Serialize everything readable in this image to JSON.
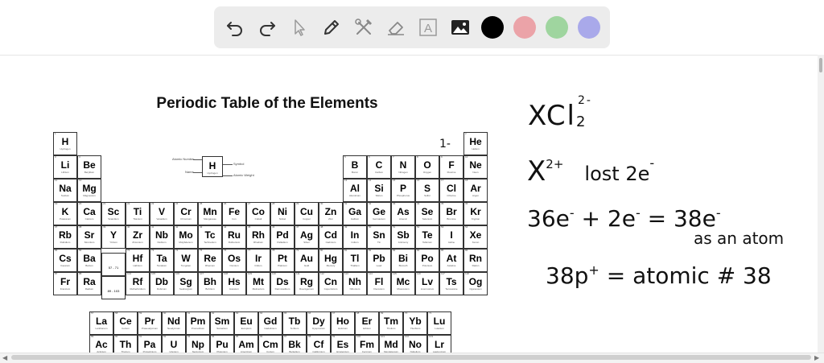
{
  "toolbar": {
    "tools": [
      "undo-icon",
      "redo-icon",
      "pointer-icon",
      "pen-icon",
      "tools-icon",
      "eraser-icon",
      "text-icon",
      "image-icon"
    ],
    "text_tool_label": "A",
    "colors": [
      "#000000",
      "#eba3a8",
      "#9fd59f",
      "#a9a9ea"
    ]
  },
  "table": {
    "title": "Periodic Table of the Elements",
    "key": {
      "atomic_number": "Atomic Number",
      "name": "Name",
      "symbol_label": "Symbol",
      "weight_label": "Atomic Weight",
      "symbol": "H",
      "element_name": "Hydrogen"
    },
    "lanthanide_placeholder": "57 - 71 Lanthanides",
    "actinide_placeholder": "89 - 103 Actinides",
    "elements": [
      {
        "n": "1",
        "s": "H",
        "nm": "Hydrogen",
        "r": 1,
        "c": 1
      },
      {
        "n": "2",
        "s": "He",
        "nm": "Helium",
        "r": 1,
        "c": 18
      },
      {
        "n": "3",
        "s": "Li",
        "nm": "Lithium",
        "r": 2,
        "c": 1
      },
      {
        "n": "4",
        "s": "Be",
        "nm": "Beryllium",
        "r": 2,
        "c": 2
      },
      {
        "n": "5",
        "s": "B",
        "nm": "Boron",
        "r": 2,
        "c": 13
      },
      {
        "n": "6",
        "s": "C",
        "nm": "Carbon",
        "r": 2,
        "c": 14
      },
      {
        "n": "7",
        "s": "N",
        "nm": "Nitrogen",
        "r": 2,
        "c": 15
      },
      {
        "n": "8",
        "s": "O",
        "nm": "Oxygen",
        "r": 2,
        "c": 16
      },
      {
        "n": "9",
        "s": "F",
        "nm": "Fluorine",
        "r": 2,
        "c": 17
      },
      {
        "n": "10",
        "s": "Ne",
        "nm": "Neon",
        "r": 2,
        "c": 18
      },
      {
        "n": "11",
        "s": "Na",
        "nm": "Sodium",
        "r": 3,
        "c": 1
      },
      {
        "n": "12",
        "s": "Mg",
        "nm": "Magnesium",
        "r": 3,
        "c": 2
      },
      {
        "n": "13",
        "s": "Al",
        "nm": "Aluminium",
        "r": 3,
        "c": 13
      },
      {
        "n": "14",
        "s": "Si",
        "nm": "Silicon",
        "r": 3,
        "c": 14
      },
      {
        "n": "15",
        "s": "P",
        "nm": "Phosphorus",
        "r": 3,
        "c": 15
      },
      {
        "n": "16",
        "s": "S",
        "nm": "Sulfur",
        "r": 3,
        "c": 16
      },
      {
        "n": "17",
        "s": "Cl",
        "nm": "Chlorine",
        "r": 3,
        "c": 17
      },
      {
        "n": "18",
        "s": "Ar",
        "nm": "Argon",
        "r": 3,
        "c": 18
      },
      {
        "n": "19",
        "s": "K",
        "nm": "Potassium",
        "r": 4,
        "c": 1
      },
      {
        "n": "20",
        "s": "Ca",
        "nm": "Calcium",
        "r": 4,
        "c": 2
      },
      {
        "n": "21",
        "s": "Sc",
        "nm": "Scandium",
        "r": 4,
        "c": 3
      },
      {
        "n": "22",
        "s": "Ti",
        "nm": "Titanium",
        "r": 4,
        "c": 4
      },
      {
        "n": "23",
        "s": "V",
        "nm": "Vanadium",
        "r": 4,
        "c": 5
      },
      {
        "n": "24",
        "s": "Cr",
        "nm": "Chromium",
        "r": 4,
        "c": 6
      },
      {
        "n": "25",
        "s": "Mn",
        "nm": "Manganese",
        "r": 4,
        "c": 7
      },
      {
        "n": "26",
        "s": "Fe",
        "nm": "Iron",
        "r": 4,
        "c": 8
      },
      {
        "n": "27",
        "s": "Co",
        "nm": "Cobalt",
        "r": 4,
        "c": 9
      },
      {
        "n": "28",
        "s": "Ni",
        "nm": "Nickel",
        "r": 4,
        "c": 10
      },
      {
        "n": "29",
        "s": "Cu",
        "nm": "Copper",
        "r": 4,
        "c": 11
      },
      {
        "n": "30",
        "s": "Zn",
        "nm": "Zinc",
        "r": 4,
        "c": 12
      },
      {
        "n": "31",
        "s": "Ga",
        "nm": "Gallium",
        "r": 4,
        "c": 13
      },
      {
        "n": "32",
        "s": "Ge",
        "nm": "Germanium",
        "r": 4,
        "c": 14
      },
      {
        "n": "33",
        "s": "As",
        "nm": "Arsenic",
        "r": 4,
        "c": 15
      },
      {
        "n": "34",
        "s": "Se",
        "nm": "Selenium",
        "r": 4,
        "c": 16
      },
      {
        "n": "35",
        "s": "Br",
        "nm": "Bromine",
        "r": 4,
        "c": 17
      },
      {
        "n": "36",
        "s": "Kr",
        "nm": "Krypton",
        "r": 4,
        "c": 18
      },
      {
        "n": "37",
        "s": "Rb",
        "nm": "Rubidium",
        "r": 5,
        "c": 1
      },
      {
        "n": "38",
        "s": "Sr",
        "nm": "Strontium",
        "r": 5,
        "c": 2
      },
      {
        "n": "39",
        "s": "Y",
        "nm": "Yttrium",
        "r": 5,
        "c": 3
      },
      {
        "n": "40",
        "s": "Zr",
        "nm": "Zirconium",
        "r": 5,
        "c": 4
      },
      {
        "n": "41",
        "s": "Nb",
        "nm": "Niobium",
        "r": 5,
        "c": 5
      },
      {
        "n": "42",
        "s": "Mo",
        "nm": "Molybdenum",
        "r": 5,
        "c": 6
      },
      {
        "n": "43",
        "s": "Tc",
        "nm": "Technetium",
        "r": 5,
        "c": 7
      },
      {
        "n": "44",
        "s": "Ru",
        "nm": "Ruthenium",
        "r": 5,
        "c": 8
      },
      {
        "n": "45",
        "s": "Rh",
        "nm": "Rhodium",
        "r": 5,
        "c": 9
      },
      {
        "n": "46",
        "s": "Pd",
        "nm": "Palladium",
        "r": 5,
        "c": 10
      },
      {
        "n": "47",
        "s": "Ag",
        "nm": "Silver",
        "r": 5,
        "c": 11
      },
      {
        "n": "48",
        "s": "Cd",
        "nm": "Cadmium",
        "r": 5,
        "c": 12
      },
      {
        "n": "49",
        "s": "In",
        "nm": "Indium",
        "r": 5,
        "c": 13
      },
      {
        "n": "50",
        "s": "Sn",
        "nm": "Tin",
        "r": 5,
        "c": 14
      },
      {
        "n": "51",
        "s": "Sb",
        "nm": "Antimony",
        "r": 5,
        "c": 15
      },
      {
        "n": "52",
        "s": "Te",
        "nm": "Tellurium",
        "r": 5,
        "c": 16
      },
      {
        "n": "53",
        "s": "I",
        "nm": "Iodine",
        "r": 5,
        "c": 17
      },
      {
        "n": "54",
        "s": "Xe",
        "nm": "Xenon",
        "r": 5,
        "c": 18
      },
      {
        "n": "55",
        "s": "Cs",
        "nm": "Caesium",
        "r": 6,
        "c": 1
      },
      {
        "n": "56",
        "s": "Ba",
        "nm": "Barium",
        "r": 6,
        "c": 2
      },
      {
        "n": "72",
        "s": "Hf",
        "nm": "Hafnium",
        "r": 6,
        "c": 4
      },
      {
        "n": "73",
        "s": "Ta",
        "nm": "Tantalum",
        "r": 6,
        "c": 5
      },
      {
        "n": "74",
        "s": "W",
        "nm": "Tungsten",
        "r": 6,
        "c": 6
      },
      {
        "n": "75",
        "s": "Re",
        "nm": "Rhenium",
        "r": 6,
        "c": 7
      },
      {
        "n": "76",
        "s": "Os",
        "nm": "Osmium",
        "r": 6,
        "c": 8
      },
      {
        "n": "77",
        "s": "Ir",
        "nm": "Iridium",
        "r": 6,
        "c": 9
      },
      {
        "n": "78",
        "s": "Pt",
        "nm": "Platinum",
        "r": 6,
        "c": 10
      },
      {
        "n": "79",
        "s": "Au",
        "nm": "Gold",
        "r": 6,
        "c": 11
      },
      {
        "n": "80",
        "s": "Hg",
        "nm": "Mercury",
        "r": 6,
        "c": 12
      },
      {
        "n": "81",
        "s": "Tl",
        "nm": "Thallium",
        "r": 6,
        "c": 13
      },
      {
        "n": "82",
        "s": "Pb",
        "nm": "Lead",
        "r": 6,
        "c": 14
      },
      {
        "n": "83",
        "s": "Bi",
        "nm": "Bismuth",
        "r": 6,
        "c": 15
      },
      {
        "n": "84",
        "s": "Po",
        "nm": "Polonium",
        "r": 6,
        "c": 16
      },
      {
        "n": "85",
        "s": "At",
        "nm": "Astatine",
        "r": 6,
        "c": 17
      },
      {
        "n": "86",
        "s": "Rn",
        "nm": "Radon",
        "r": 6,
        "c": 18
      },
      {
        "n": "87",
        "s": "Fr",
        "nm": "Francium",
        "r": 7,
        "c": 1
      },
      {
        "n": "88",
        "s": "Ra",
        "nm": "Radium",
        "r": 7,
        "c": 2
      },
      {
        "n": "104",
        "s": "Rf",
        "nm": "Rutherfordium",
        "r": 7,
        "c": 4
      },
      {
        "n": "105",
        "s": "Db",
        "nm": "Dubnium",
        "r": 7,
        "c": 5
      },
      {
        "n": "106",
        "s": "Sg",
        "nm": "Seaborgium",
        "r": 7,
        "c": 6
      },
      {
        "n": "107",
        "s": "Bh",
        "nm": "Bohrium",
        "r": 7,
        "c": 7
      },
      {
        "n": "108",
        "s": "Hs",
        "nm": "Hassium",
        "r": 7,
        "c": 8
      },
      {
        "n": "109",
        "s": "Mt",
        "nm": "Meitnerium",
        "r": 7,
        "c": 9
      },
      {
        "n": "110",
        "s": "Ds",
        "nm": "Darmstadtium",
        "r": 7,
        "c": 10
      },
      {
        "n": "111",
        "s": "Rg",
        "nm": "Roentgenium",
        "r": 7,
        "c": 11
      },
      {
        "n": "112",
        "s": "Cn",
        "nm": "Copernicium",
        "r": 7,
        "c": 12
      },
      {
        "n": "113",
        "s": "Nh",
        "nm": "Nihonium",
        "r": 7,
        "c": 13
      },
      {
        "n": "114",
        "s": "Fl",
        "nm": "Flerovium",
        "r": 7,
        "c": 14
      },
      {
        "n": "115",
        "s": "Mc",
        "nm": "Moscovium",
        "r": 7,
        "c": 15
      },
      {
        "n": "116",
        "s": "Lv",
        "nm": "Livermorium",
        "r": 7,
        "c": 16
      },
      {
        "n": "117",
        "s": "Ts",
        "nm": "Tennessine",
        "r": 7,
        "c": 17
      },
      {
        "n": "118",
        "s": "Og",
        "nm": "Oganesson",
        "r": 7,
        "c": 18
      },
      {
        "n": "57",
        "s": "La",
        "nm": "Lanthanum",
        "r": 9,
        "c": 1
      },
      {
        "n": "58",
        "s": "Ce",
        "nm": "Cerium",
        "r": 9,
        "c": 2
      },
      {
        "n": "59",
        "s": "Pr",
        "nm": "Praseodymium",
        "r": 9,
        "c": 3
      },
      {
        "n": "60",
        "s": "Nd",
        "nm": "Neodymium",
        "r": 9,
        "c": 4
      },
      {
        "n": "61",
        "s": "Pm",
        "nm": "Promethium",
        "r": 9,
        "c": 5
      },
      {
        "n": "62",
        "s": "Sm",
        "nm": "Samarium",
        "r": 9,
        "c": 6
      },
      {
        "n": "63",
        "s": "Eu",
        "nm": "Europium",
        "r": 9,
        "c": 7
      },
      {
        "n": "64",
        "s": "Gd",
        "nm": "Gadolinium",
        "r": 9,
        "c": 8
      },
      {
        "n": "65",
        "s": "Tb",
        "nm": "Terbium",
        "r": 9,
        "c": 9
      },
      {
        "n": "66",
        "s": "Dy",
        "nm": "Dysprosium",
        "r": 9,
        "c": 10
      },
      {
        "n": "67",
        "s": "Ho",
        "nm": "Holmium",
        "r": 9,
        "c": 11
      },
      {
        "n": "68",
        "s": "Er",
        "nm": "Erbium",
        "r": 9,
        "c": 12
      },
      {
        "n": "69",
        "s": "Tm",
        "nm": "Thulium",
        "r": 9,
        "c": 13
      },
      {
        "n": "70",
        "s": "Yb",
        "nm": "Ytterbium",
        "r": 9,
        "c": 14
      },
      {
        "n": "71",
        "s": "Lu",
        "nm": "Lutetium",
        "r": 9,
        "c": 15
      },
      {
        "n": "89",
        "s": "Ac",
        "nm": "Actinium",
        "r": 10,
        "c": 1
      },
      {
        "n": "90",
        "s": "Th",
        "nm": "Thorium",
        "r": 10,
        "c": 2
      },
      {
        "n": "91",
        "s": "Pa",
        "nm": "Protactinium",
        "r": 10,
        "c": 3
      },
      {
        "n": "92",
        "s": "U",
        "nm": "Uranium",
        "r": 10,
        "c": 4
      },
      {
        "n": "93",
        "s": "Np",
        "nm": "Neptunium",
        "r": 10,
        "c": 5
      },
      {
        "n": "94",
        "s": "Pu",
        "nm": "Plutonium",
        "r": 10,
        "c": 6
      },
      {
        "n": "95",
        "s": "Am",
        "nm": "Americium",
        "r": 10,
        "c": 7
      },
      {
        "n": "96",
        "s": "Cm",
        "nm": "Curium",
        "r": 10,
        "c": 8
      },
      {
        "n": "97",
        "s": "Bk",
        "nm": "Berkelium",
        "r": 10,
        "c": 9
      },
      {
        "n": "98",
        "s": "Cf",
        "nm": "Californium",
        "r": 10,
        "c": 10
      },
      {
        "n": "99",
        "s": "Es",
        "nm": "Einsteinium",
        "r": 10,
        "c": 11
      },
      {
        "n": "100",
        "s": "Fm",
        "nm": "Fermium",
        "r": 10,
        "c": 12
      },
      {
        "n": "101",
        "s": "Md",
        "nm": "Mendelevium",
        "r": 10,
        "c": 13
      },
      {
        "n": "102",
        "s": "No",
        "nm": "Nobelium",
        "r": 10,
        "c": 14
      },
      {
        "n": "103",
        "s": "Lr",
        "nm": "Lawrencium",
        "r": 10,
        "c": 15
      }
    ]
  },
  "notes": {
    "fluorine_charge": "1-",
    "line1_main": "XCl",
    "line1_sup": "2-",
    "line1_sub": "2",
    "line2_main": "X",
    "line2_sup": "2+",
    "line2_text": "lost 2e",
    "line2_text_sup": "-",
    "line3_a": "36e",
    "line3_a_sup": "-",
    "line3_b": " + 2e",
    "line3_b_sup": "-",
    "line3_c": " = 38e",
    "line3_c_sup": "-",
    "line4": "as an atom",
    "line5_a": "38p",
    "line5_a_sup": "+",
    "line5_b": " = atomic # 38"
  }
}
